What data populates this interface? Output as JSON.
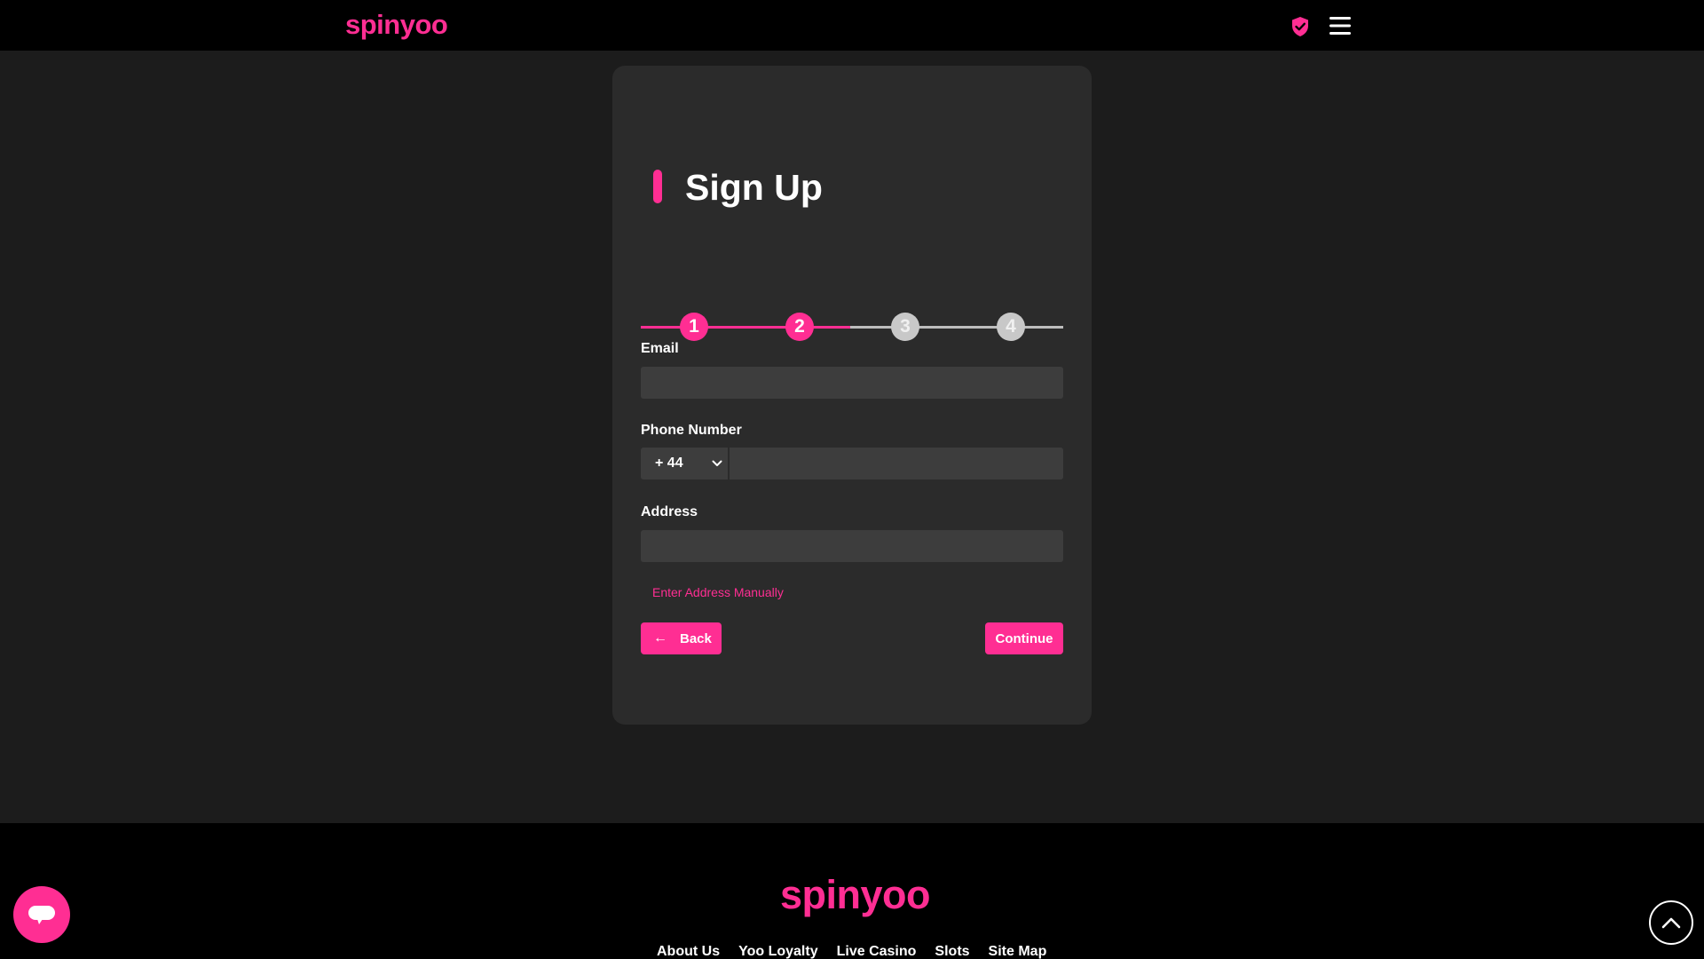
{
  "header": {
    "logo_text": "spinyoo",
    "icons": [
      "shield-check-icon",
      "hamburger-menu-icon"
    ]
  },
  "form": {
    "title": "Sign Up",
    "steps": [
      {
        "number": "1",
        "state": "complete"
      },
      {
        "number": "2",
        "state": "current"
      },
      {
        "number": "3",
        "state": "pending"
      },
      {
        "number": "4",
        "state": "pending"
      }
    ],
    "email": {
      "label": "Email",
      "value": "",
      "placeholder": ""
    },
    "phone": {
      "label": "Phone Number",
      "country_code": "+ 44",
      "value": "",
      "placeholder": ""
    },
    "address": {
      "label": "Address",
      "value": "",
      "placeholder": ""
    },
    "manual_address_link": "Enter Address Manually",
    "back_label": "Back",
    "continue_label": "Continue"
  },
  "footer": {
    "logo_text": "spinyoo",
    "links": [
      "About Us",
      "Yoo Loyalty",
      "Live Casino",
      "Slots",
      "Site Map"
    ]
  },
  "colors": {
    "accent": "#ff2e93",
    "page_bg": "#1c1c1c",
    "card_bg": "#2b2b2b",
    "input_bg": "#3d3d3d",
    "bar_bg": "#000000"
  }
}
